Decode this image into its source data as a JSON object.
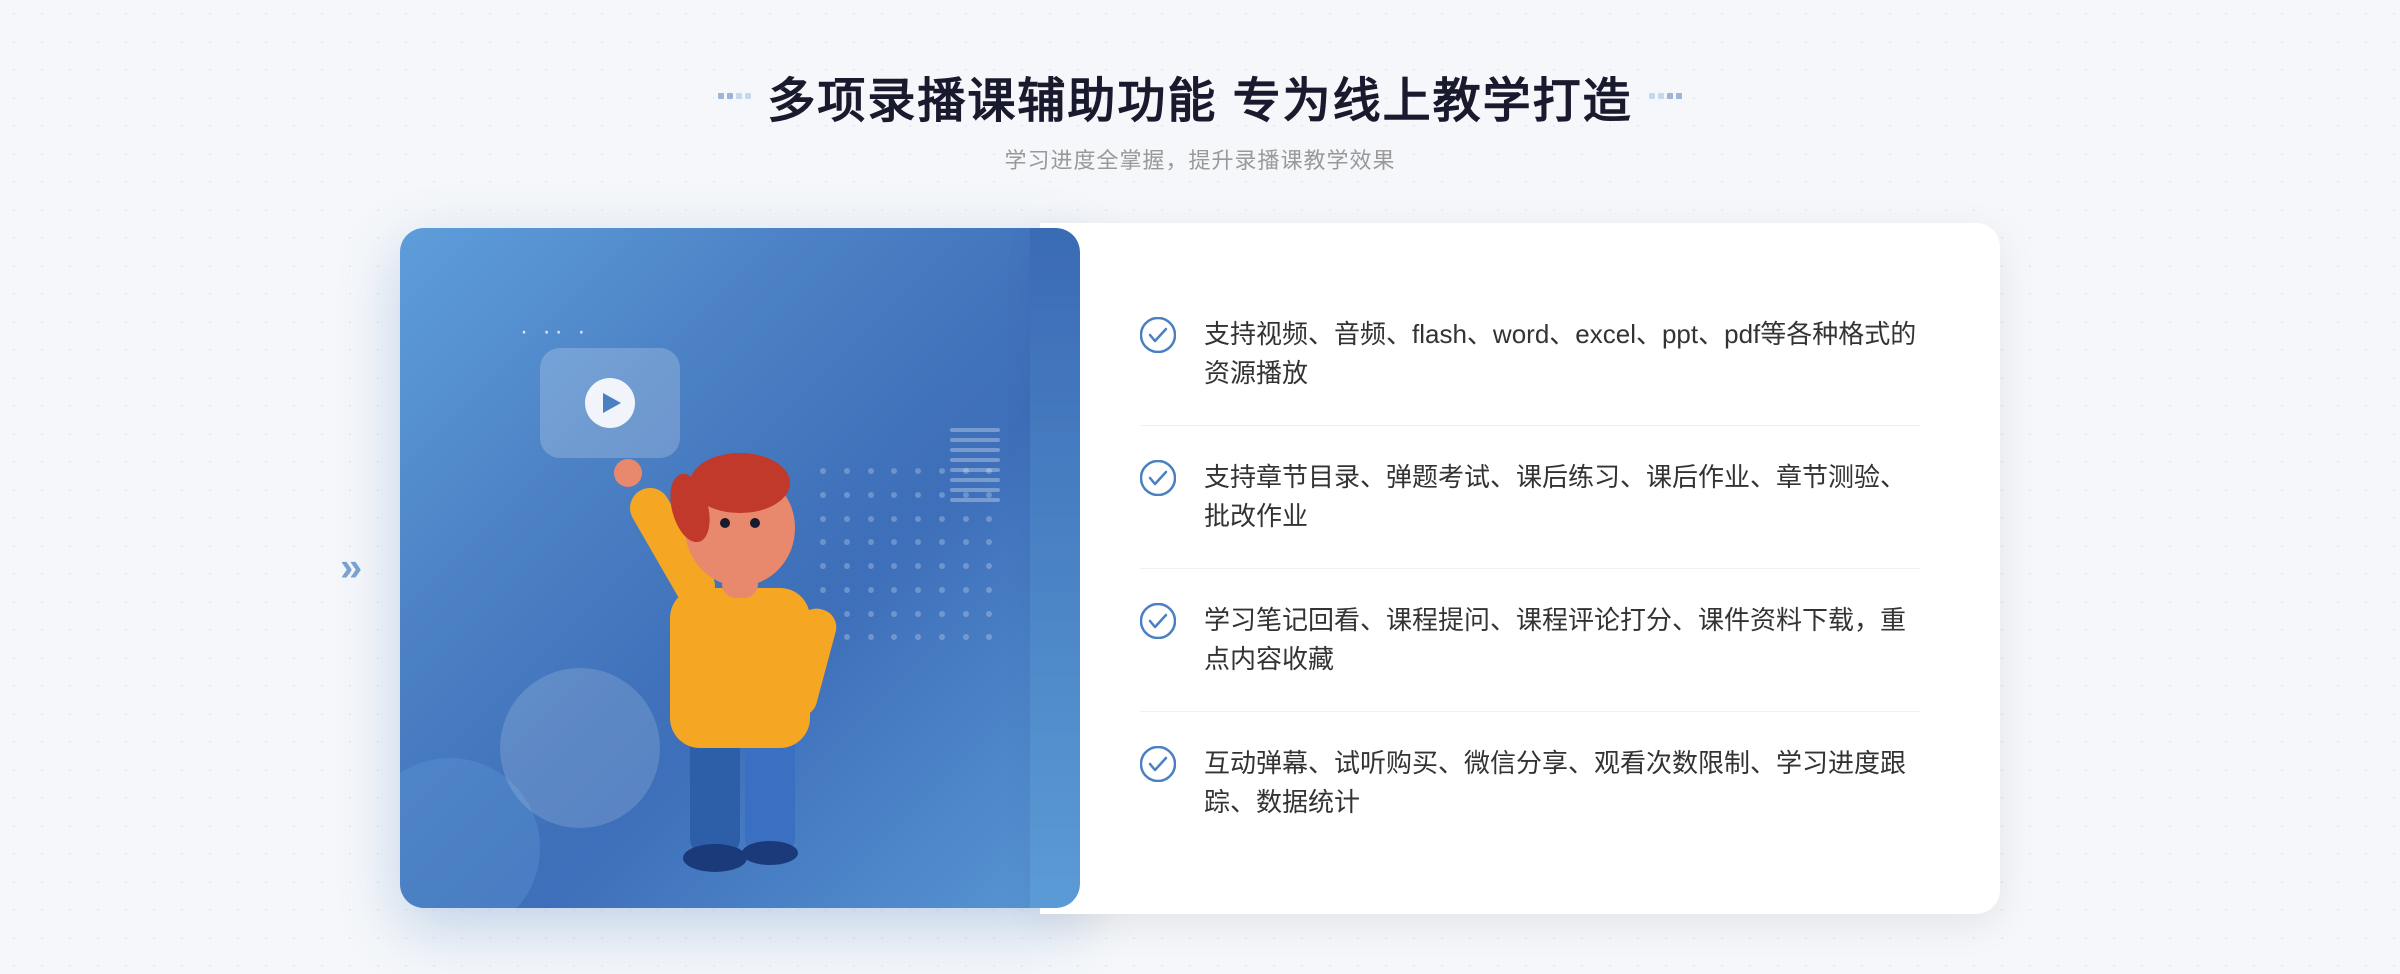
{
  "header": {
    "title": "多项录播课辅助功能 专为线上教学打造",
    "subtitle": "学习进度全掌握，提升录播课教学效果",
    "left_deco_label": "title-left-decorator",
    "right_deco_label": "title-right-decorator"
  },
  "features": [
    {
      "id": 1,
      "text": "支持视频、音频、flash、word、excel、ppt、pdf等各种格式的资源播放"
    },
    {
      "id": 2,
      "text": "支持章节目录、弹题考试、课后练习、课后作业、章节测验、批改作业"
    },
    {
      "id": 3,
      "text": "学习笔记回看、课程提问、课程评论打分、课件资料下载，重点内容收藏"
    },
    {
      "id": 4,
      "text": "互动弹幕、试听购买、微信分享、观看次数限制、学习进度跟踪、数据统计"
    }
  ],
  "colors": {
    "primary_blue": "#4a7fc1",
    "light_blue": "#5b9bd5",
    "check_color": "#4a7fc1",
    "title_color": "#1a1a2e",
    "text_color": "#333333",
    "subtitle_color": "#999999"
  },
  "icons": {
    "check": "checkmark-circle",
    "play": "play-circle",
    "left_arrow": "chevron-right-double",
    "right_arrow": "chevron-right-double"
  }
}
